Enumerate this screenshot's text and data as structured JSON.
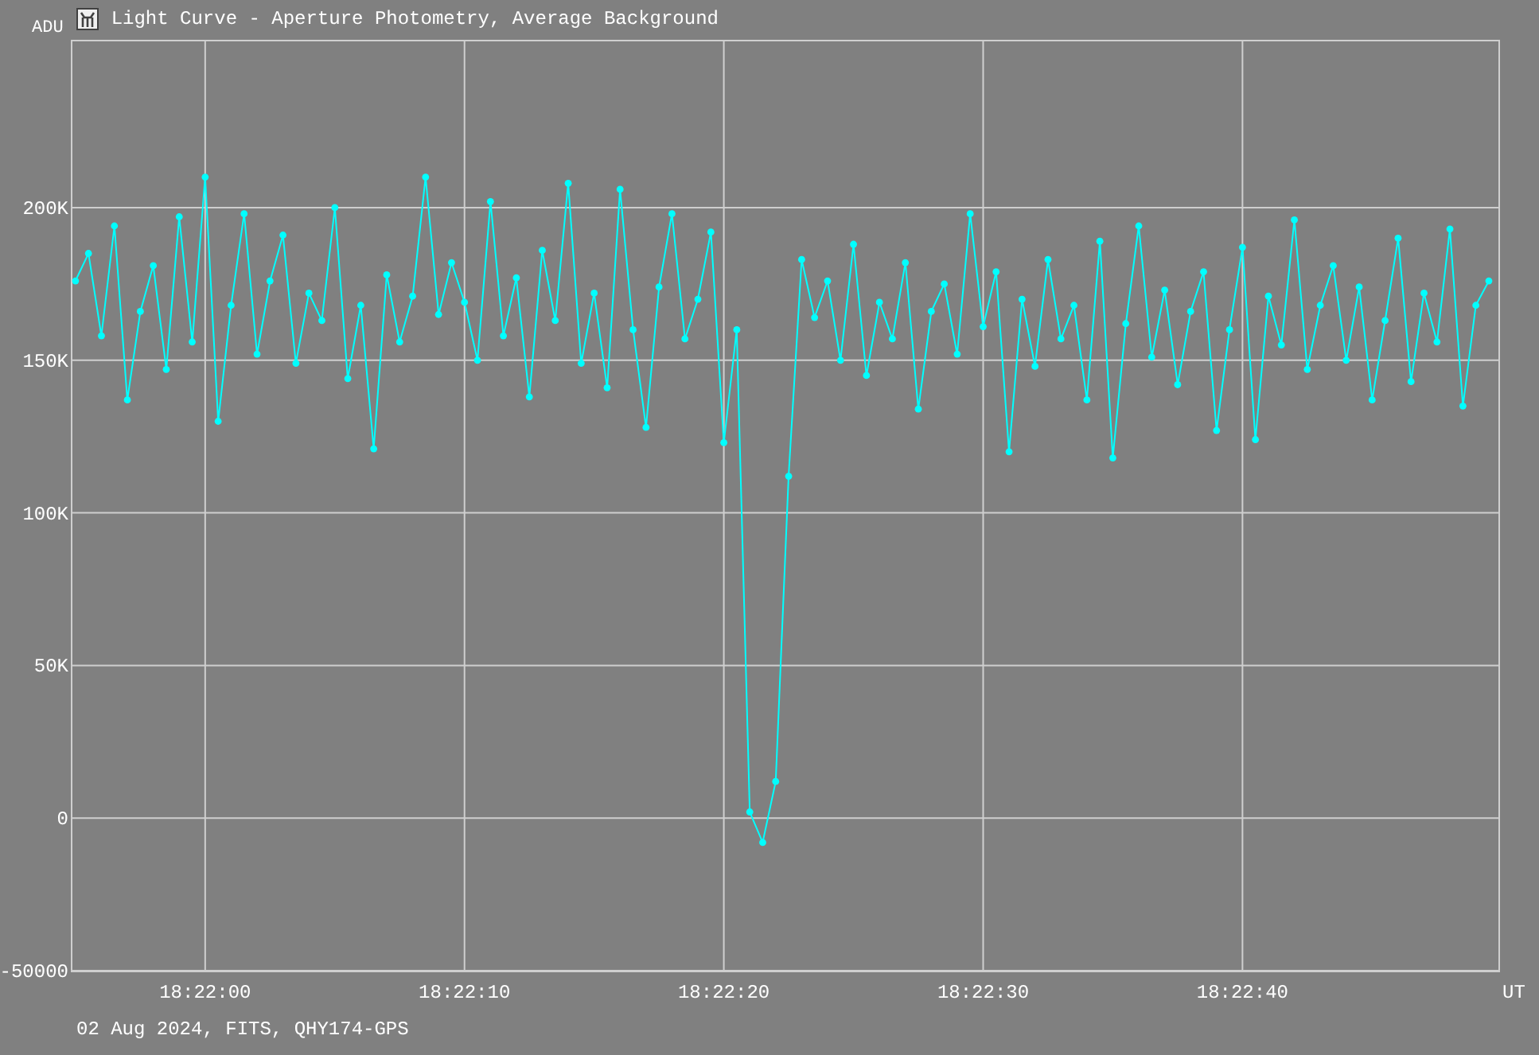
{
  "window": {
    "title": "Light Curve - Aperture Photometry, Average Background"
  },
  "chart": {
    "chart_data": {
      "type": "line",
      "xlabel": "UT",
      "ylabel": "ADU",
      "categories": [
        null,
        null,
        null,
        null,
        null,
        null,
        null,
        null,
        null,
        null,
        "18:22:00",
        null,
        null,
        null,
        null,
        null,
        null,
        null,
        null,
        null,
        null,
        null,
        null,
        null,
        null,
        null,
        null,
        null,
        null,
        null,
        "18:22:10",
        null,
        null,
        null,
        null,
        null,
        null,
        null,
        null,
        null,
        null,
        null,
        null,
        null,
        null,
        null,
        null,
        null,
        null,
        null,
        "18:22:20",
        null,
        null,
        null,
        null,
        null,
        null,
        null,
        null,
        null,
        null,
        null,
        null,
        null,
        null,
        null,
        null,
        null,
        null,
        null,
        "18:22:30",
        null,
        null,
        null,
        null,
        null,
        null,
        null,
        null,
        null,
        null,
        null,
        null,
        null,
        null,
        null,
        null,
        null,
        null,
        null,
        "18:22:40",
        null,
        null,
        null,
        null,
        null,
        null,
        null,
        null,
        null,
        null,
        null,
        null,
        null,
        null,
        null,
        null,
        null,
        null,
        null
      ],
      "series": [
        {
          "color": "#00ffff",
          "marker": "circle",
          "values": [
            176000,
            185000,
            158000,
            194000,
            137000,
            166000,
            181000,
            147000,
            197000,
            156000,
            210000,
            130000,
            168000,
            198000,
            152000,
            176000,
            191000,
            149000,
            172000,
            163000,
            200000,
            144000,
            168000,
            121000,
            178000,
            156000,
            171000,
            210000,
            165000,
            182000,
            169000,
            150000,
            202000,
            158000,
            177000,
            138000,
            186000,
            163000,
            208000,
            149000,
            172000,
            141000,
            206000,
            160000,
            128000,
            174000,
            198000,
            157000,
            170000,
            192000,
            123000,
            160000,
            2000,
            -8000,
            12000,
            112000,
            183000,
            164000,
            176000,
            150000,
            188000,
            145000,
            169000,
            157000,
            182000,
            134000,
            166000,
            175000,
            152000,
            198000,
            161000,
            179000,
            120000,
            170000,
            148000,
            183000,
            157000,
            168000,
            137000,
            189000,
            118000,
            162000,
            194000,
            151000,
            173000,
            142000,
            166000,
            179000,
            127000,
            160000,
            187000,
            124000,
            171000,
            155000,
            196000,
            147000,
            168000,
            181000,
            150000,
            174000,
            137000,
            163000,
            190000,
            143000,
            172000,
            156000,
            193000,
            135000,
            168000,
            176000
          ]
        }
      ],
      "grid": true,
      "ylim": [
        -50000,
        255000
      ],
      "yticks": [
        {
          "value": -50000,
          "label": "-50000"
        },
        {
          "value": 0,
          "label": "0"
        },
        {
          "value": 50000,
          "label": "50K"
        },
        {
          "value": 100000,
          "label": "100K"
        },
        {
          "value": 150000,
          "label": "150K"
        },
        {
          "value": 200000,
          "label": "200K"
        }
      ]
    }
  },
  "footer": "02 Aug 2024, FITS, QHY174-GPS"
}
